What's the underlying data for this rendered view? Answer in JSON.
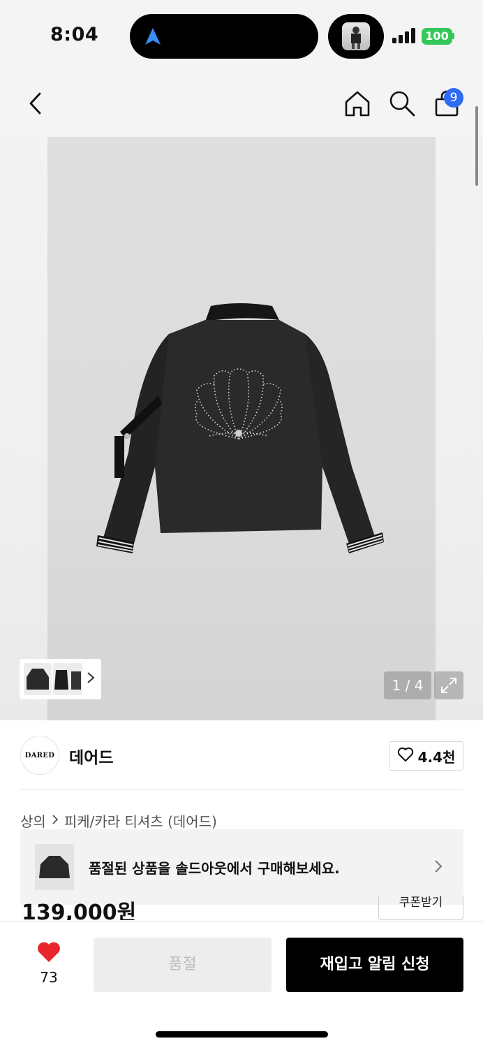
{
  "status": {
    "time": "8:04",
    "battery": "100"
  },
  "nav": {
    "cart_count": "9"
  },
  "gallery": {
    "counter": "1 / 4"
  },
  "brand": {
    "logo_text": "DARED",
    "name": "데어드",
    "likes": "4.4천"
  },
  "breadcrumb": {
    "category": "상의",
    "subcategory": "피케/카라 티셔츠 (데어드)"
  },
  "soldout_banner": {
    "text": "품절된 상품을 솔드아웃에서 구매해보세요."
  },
  "price": {
    "amount": "139,000원",
    "coupon": "쿠폰받기"
  },
  "bottom": {
    "wish_count": "73",
    "soldout_label": "품절",
    "restock_label": "재입고 알림 신청"
  },
  "colors": {
    "accent_blue": "#2f6cf2",
    "battery_green": "#34c759",
    "heart_red": "#e8262b"
  }
}
